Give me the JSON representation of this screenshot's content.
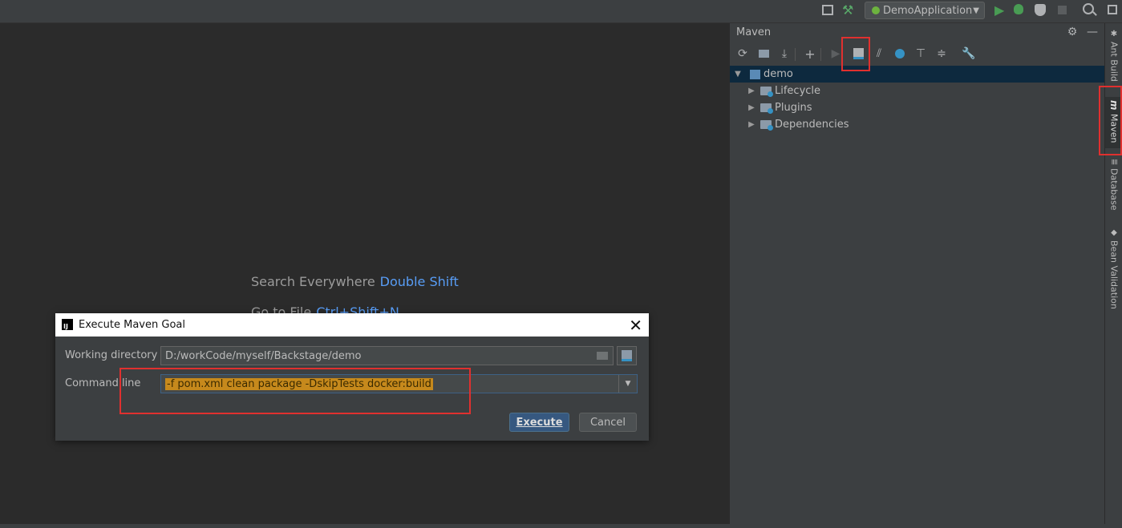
{
  "toolbar": {
    "run_config": "DemoApplication",
    "icons": [
      "project-structure-icon",
      "build-hammer-icon",
      "run-icon",
      "debug-icon",
      "coverage-icon",
      "stop-icon",
      "search-icon"
    ]
  },
  "editor": {
    "hint_search_label": "Search Everywhere",
    "hint_search_key": "Double Shift",
    "hint_goto_label": "Go to File",
    "hint_goto_key": "Ctrl+Shift+N"
  },
  "maven": {
    "title": "Maven",
    "tree": {
      "root": "demo",
      "children": [
        "Lifecycle",
        "Plugins",
        "Dependencies"
      ]
    }
  },
  "right_strip": {
    "tabs": [
      "Ant Build",
      "Maven",
      "Database",
      "Bean Validation"
    ]
  },
  "dialog": {
    "title": "Execute Maven Goal",
    "working_dir_label": "Working directory",
    "working_dir_value": "D:/workCode/myself/Backstage/demo",
    "command_line_label": "Command line",
    "command_line_value": "-f pom.xml clean package -DskipTests docker:build",
    "execute_label": "Execute",
    "cancel_label": "Cancel"
  },
  "colors": {
    "accent": "#589df6",
    "highlight": "#e0302f",
    "selection": "#0d293e"
  }
}
